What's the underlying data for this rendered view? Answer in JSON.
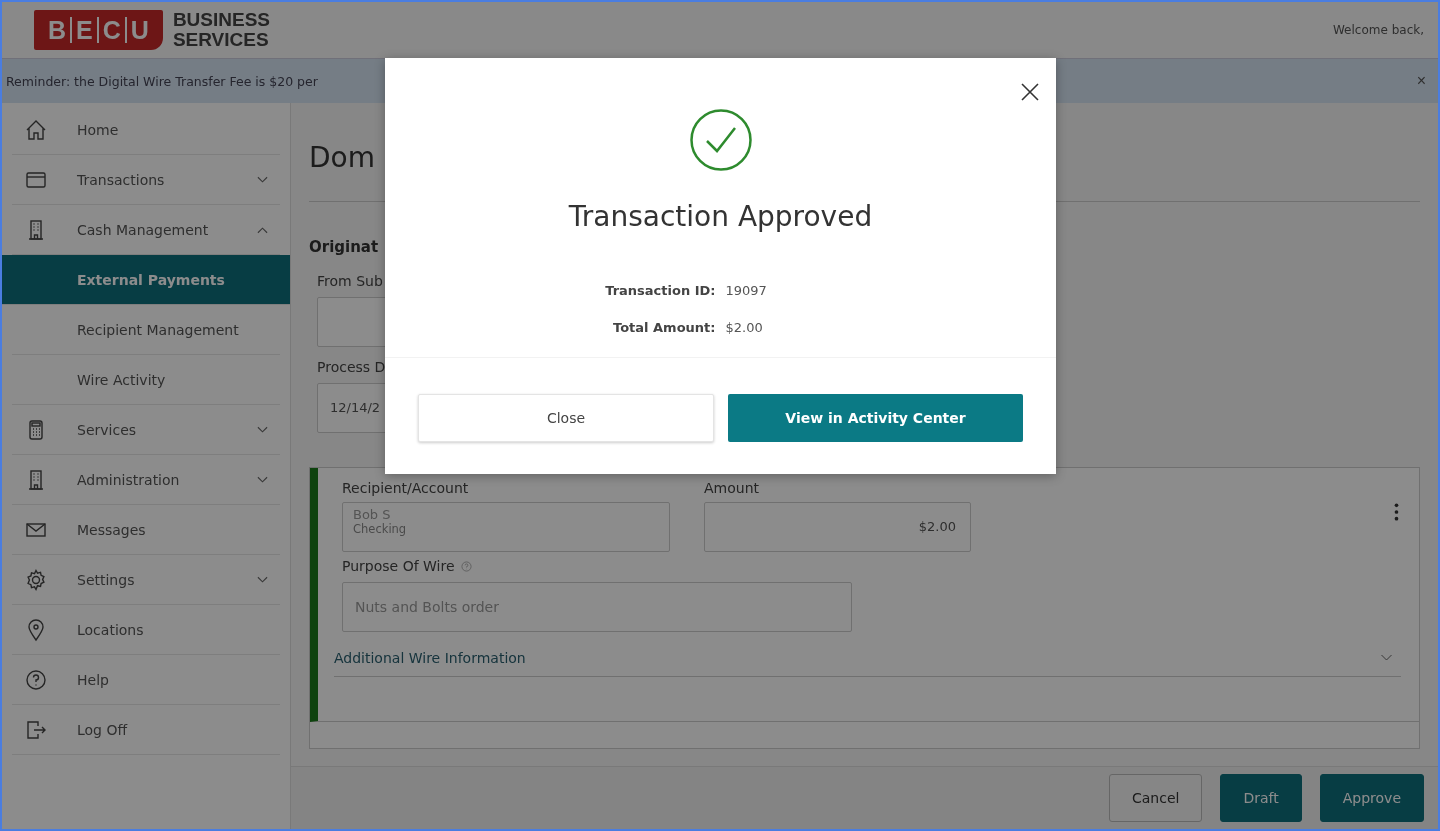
{
  "header": {
    "logo_letters": [
      "B",
      "E",
      "C",
      "U"
    ],
    "brand_lines": [
      "BUSINESS",
      "SERVICES"
    ],
    "welcome": "Welcome back,"
  },
  "banner": {
    "text": "Reminder: the Digital Wire Transfer Fee is $20 per",
    "close": "×"
  },
  "sidebar": {
    "items": [
      {
        "kind": "main",
        "label": "Home",
        "selected": false
      },
      {
        "kind": "main",
        "label": "Transactions",
        "selected": false,
        "expanded": false
      },
      {
        "kind": "main",
        "label": "Cash Management",
        "selected": false,
        "expanded": true
      },
      {
        "kind": "sub",
        "label": "External Payments",
        "selected": true
      },
      {
        "kind": "sub",
        "label": "Recipient Management",
        "selected": false
      },
      {
        "kind": "sub",
        "label": "Wire Activity",
        "selected": false
      },
      {
        "kind": "main",
        "label": "Services",
        "selected": false,
        "expanded": false
      },
      {
        "kind": "main",
        "label": "Administration",
        "selected": false,
        "expanded": false
      },
      {
        "kind": "main",
        "label": "Messages",
        "selected": false
      },
      {
        "kind": "main",
        "label": "Settings",
        "selected": false,
        "expanded": false
      },
      {
        "kind": "main",
        "label": "Locations",
        "selected": false
      },
      {
        "kind": "main",
        "label": "Help",
        "selected": false
      },
      {
        "kind": "main",
        "label": "Log Off",
        "selected": false
      }
    ]
  },
  "main": {
    "title": "Dom",
    "section": "Originat",
    "from_label": "From Sub",
    "process_label": "Process D",
    "process_value": "12/14/2",
    "wire": {
      "recipient_label": "Recipient/Account",
      "recipient_name": "Bob S",
      "recipient_account": "Checking",
      "amount_label": "Amount",
      "amount_value": "$2.00",
      "purpose_label": "Purpose Of Wire",
      "purpose_value": "Nuts and Bolts order",
      "additional": "Additional Wire Information",
      "additional_expanded": false
    }
  },
  "footer_buttons": [
    {
      "kind": "secondary",
      "label": "Cancel"
    },
    {
      "kind": "primary",
      "label": "Draft"
    },
    {
      "kind": "primary",
      "label": "Approve"
    }
  ],
  "modal": {
    "title": "Transaction Approved",
    "details": [
      {
        "label": "Transaction ID:",
        "value": "19097"
      },
      {
        "label": "Total Amount:",
        "value": "$2.00"
      }
    ],
    "buttons": [
      {
        "kind": "secondary",
        "label": "Close"
      },
      {
        "kind": "primary",
        "label": "View in Activity Center"
      }
    ]
  }
}
